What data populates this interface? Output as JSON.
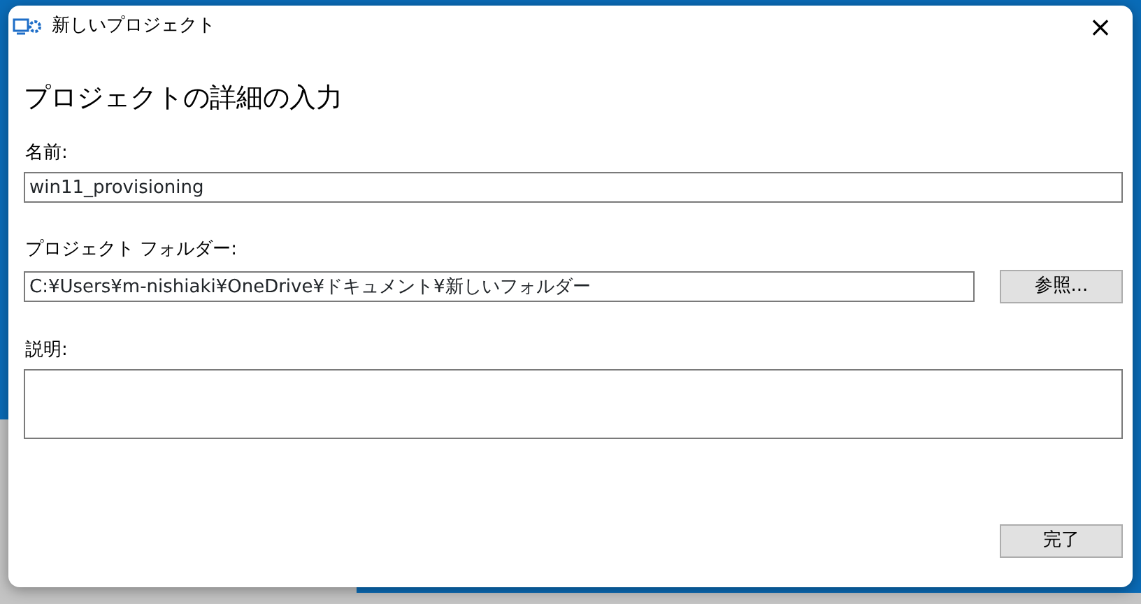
{
  "window": {
    "title": "新しいプロジェクト",
    "close": "×"
  },
  "heading": "プロジェクトの詳細の入力",
  "name_field": {
    "label": "名前:",
    "value": "win11_provisioning"
  },
  "folder_field": {
    "label": "プロジェクト フォルダー:",
    "value": "C:¥Users¥m-nishiaki¥OneDrive¥ドキュメント¥新しいフォルダー",
    "button": "参照..."
  },
  "description_field": {
    "label": "説明:"
  },
  "buttons": [
    "完了"
  ]
}
